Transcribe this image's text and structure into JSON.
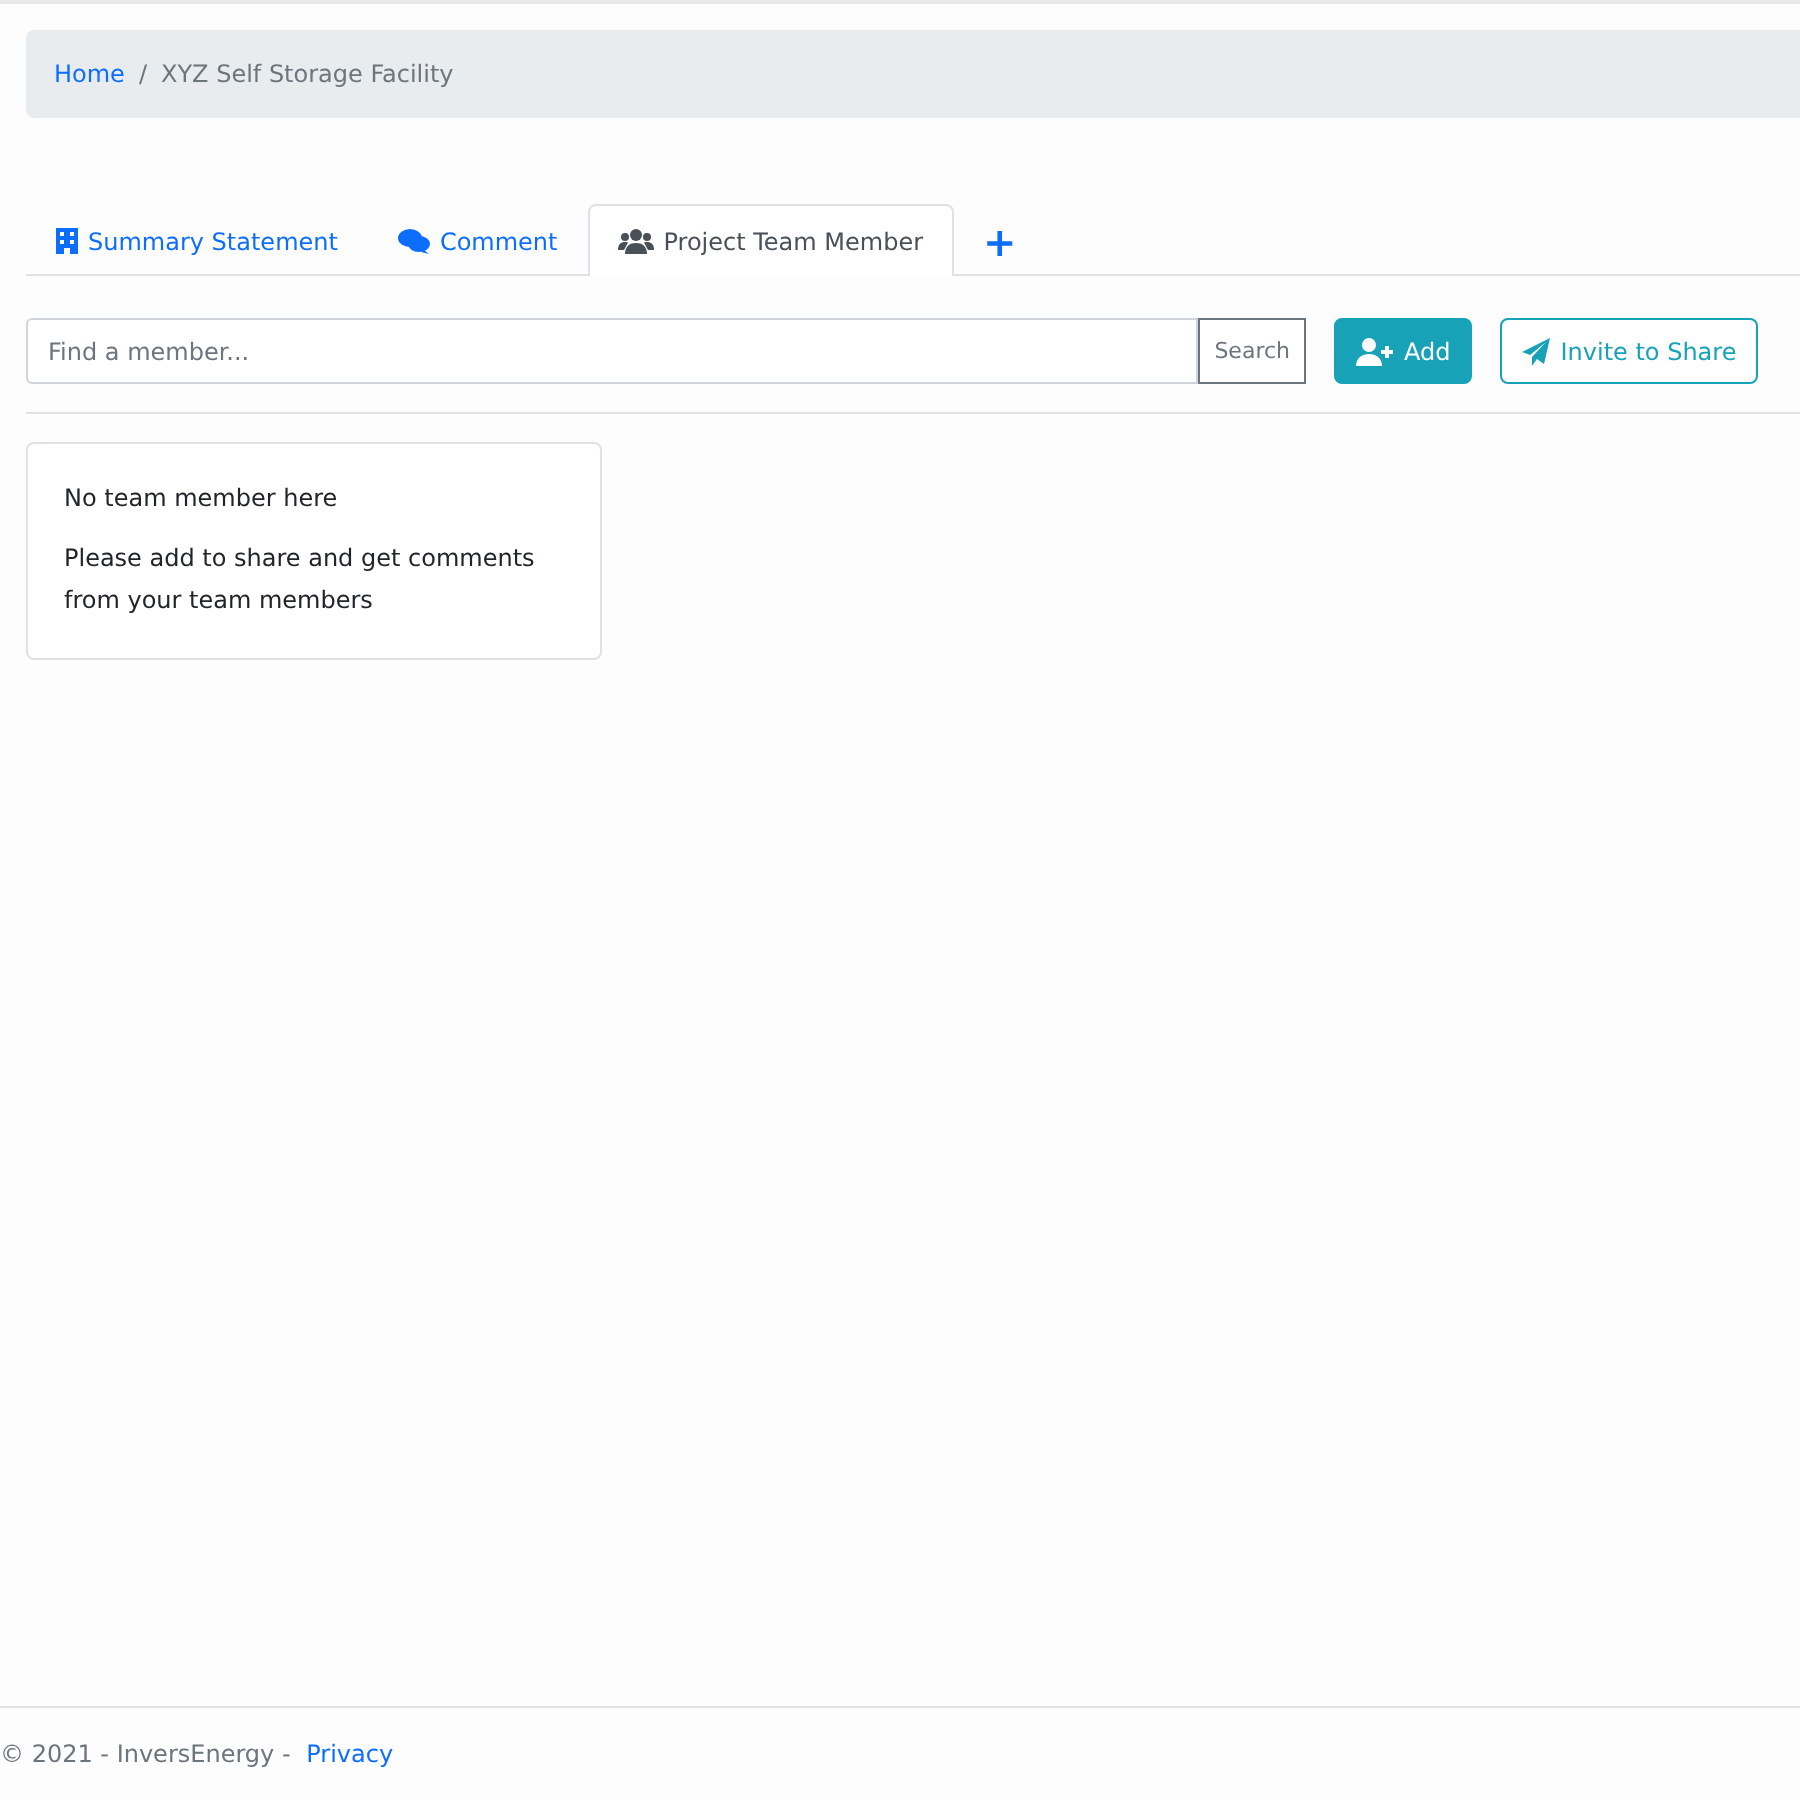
{
  "breadcrumb": [
    {
      "label": "Home",
      "kind": "link"
    },
    {
      "label": "/",
      "kind": "separator"
    },
    {
      "label": "XYZ Self Storage Facility",
      "kind": "current"
    }
  ],
  "tabs": [
    {
      "label": "Summary Statement",
      "kind": "building",
      "selected": false
    },
    {
      "label": "Comment",
      "kind": "comments",
      "selected": false
    },
    {
      "label": "Project Team Member",
      "kind": "users",
      "selected": true
    },
    {
      "label": "+",
      "kind": "add",
      "selected": false
    }
  ],
  "search": {
    "placeholder": "Find a member...",
    "button": "Search"
  },
  "buttons": [
    {
      "label": "Add",
      "kind": "primary"
    },
    {
      "label": "Invite to Share",
      "kind": "outline"
    }
  ],
  "empty_card": {
    "title": "No team member here",
    "message": "Please add to share and get comments from your team members"
  },
  "footer": {
    "text": "© 2021 - InversEnergy - ",
    "link": "Privacy"
  }
}
